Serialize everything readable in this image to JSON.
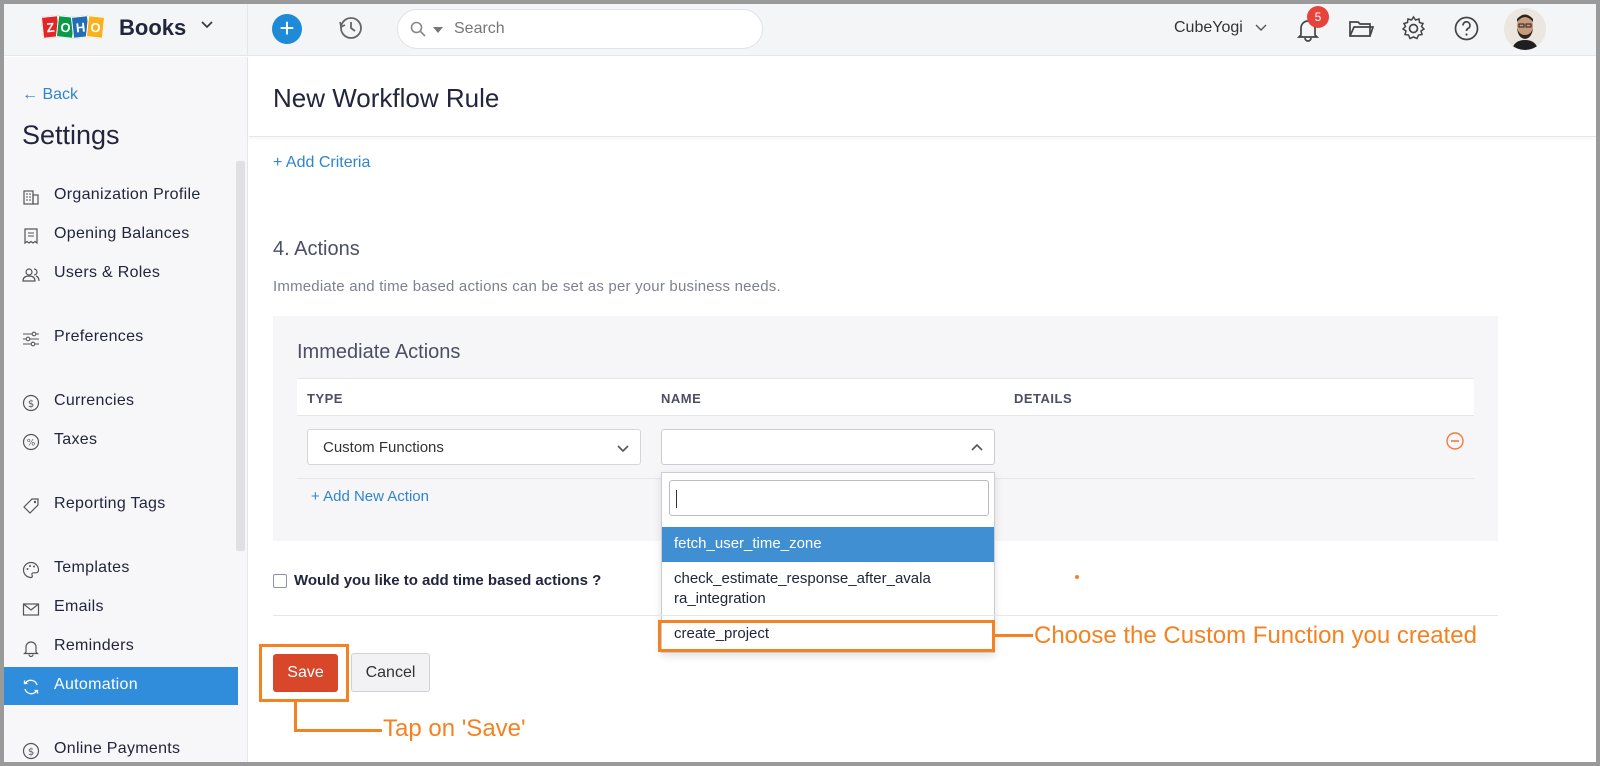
{
  "app": {
    "brand_logo": "ZOHO",
    "brand_name": "Books",
    "org_name": "CubeYogi",
    "notification_count": "5",
    "search_placeholder": "Search"
  },
  "sidebar": {
    "back_label": "Back",
    "title": "Settings",
    "items": [
      {
        "label": "Organization Profile",
        "icon": "building-icon"
      },
      {
        "label": "Opening Balances",
        "icon": "ledger-icon"
      },
      {
        "label": "Users & Roles",
        "icon": "users-icon"
      },
      {
        "label": "Preferences",
        "icon": "sliders-icon"
      },
      {
        "label": "Currencies",
        "icon": "currency-icon"
      },
      {
        "label": "Taxes",
        "icon": "percent-icon"
      },
      {
        "label": "Reporting Tags",
        "icon": "tag-icon"
      },
      {
        "label": "Templates",
        "icon": "palette-icon"
      },
      {
        "label": "Emails",
        "icon": "mail-icon"
      },
      {
        "label": "Reminders",
        "icon": "bell-icon"
      },
      {
        "label": "Automation",
        "icon": "sync-icon",
        "active": true
      },
      {
        "label": "Online Payments",
        "icon": "payment-icon"
      }
    ]
  },
  "page": {
    "title": "New Workflow Rule",
    "add_criteria": "+ Add Criteria",
    "actions_title": "4. Actions",
    "actions_desc": "Immediate and time based actions can be set as per your business needs.",
    "immediate": {
      "title": "Immediate Actions",
      "columns": [
        "TYPE",
        "NAME",
        "DETAILS"
      ],
      "type_value": "Custom Functions",
      "name_value": "",
      "add_action": "+ Add New Action"
    },
    "name_dropdown": {
      "search_value": "",
      "options": [
        "fetch_user_time_zone",
        "check_estimate_response_after_avala\nra_integration",
        "create_project"
      ],
      "highlighted_index": 0
    },
    "time_based_label": "Would you like to add time based actions ?",
    "time_based_checked": false,
    "save_label": "Save",
    "cancel_label": "Cancel"
  },
  "annotations": {
    "choose_text": "Choose the Custom Function you created",
    "save_text": "Tap on 'Save'",
    "color": "#f58220"
  },
  "colors": {
    "accent": "#2f8ddb",
    "link": "#2f85cc",
    "save": "#d9472b"
  }
}
